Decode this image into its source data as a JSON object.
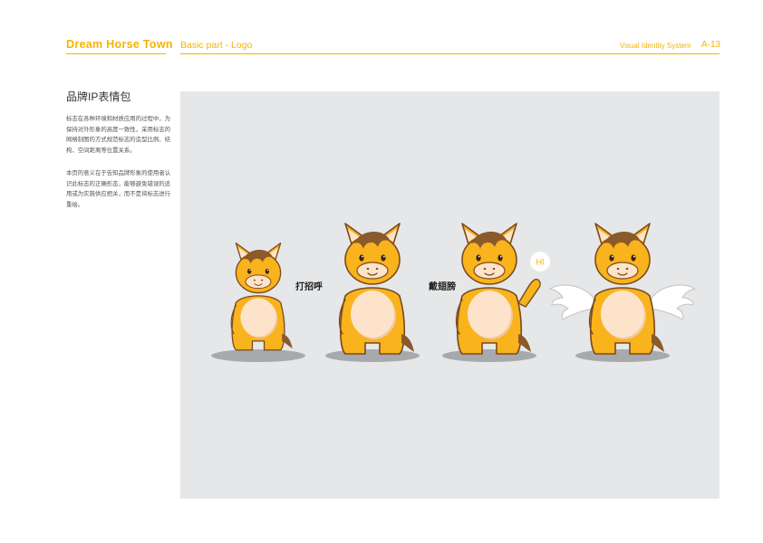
{
  "header": {
    "brand": "Dream Horse Town",
    "section": "Basic part - Logo",
    "system": "Visual Identity System",
    "page_number": "A-13"
  },
  "sidebar": {
    "title": "品牌IP表情包",
    "paragraphs": [
      "标志在各种环境和材质应用的过程中，为保持对外形象的高度一致性，采用标志的网格制图的方式规范标志的造型比例、结构、空间距离等位置关系。",
      "本页的意义在于告知品牌形象的使用者认识此标志的正确形态，能够避免错误的适用或为实施供应把关，而不是将标志进行重绘。"
    ]
  },
  "figures": {
    "speech_bubble": "HI",
    "captions": [
      "打招呼",
      "戴翅膀"
    ]
  },
  "colors": {
    "accent": "#f5b400",
    "horse_body": "#f9b31c",
    "horse_belly": "#fde3c9",
    "mane": "#8a5a2b",
    "panel_bg": "#e6e7e8"
  }
}
